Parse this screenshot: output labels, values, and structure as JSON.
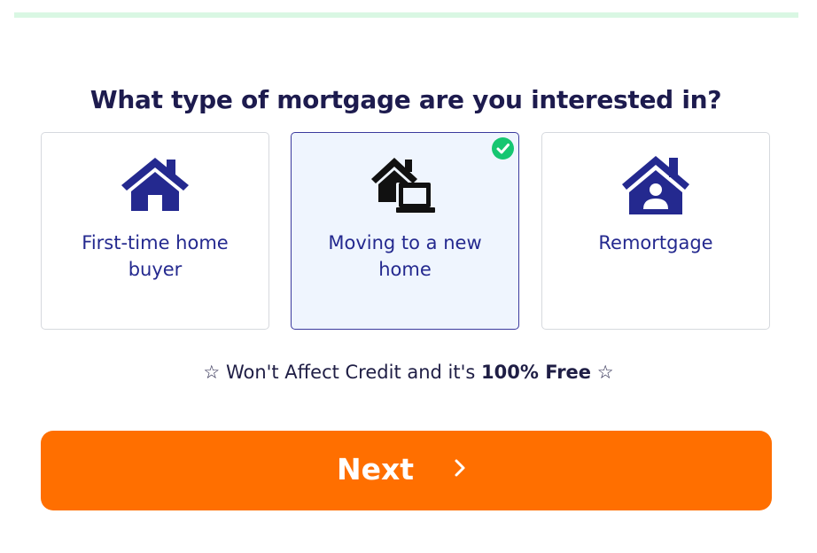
{
  "progress": {
    "value": 0.2,
    "color": "#d9f7e3"
  },
  "question": {
    "title": "What type of mortgage are you interested in?"
  },
  "options": [
    {
      "label": "First-time home buyer",
      "icon": "house-icon",
      "selected": false
    },
    {
      "label": "Moving to a new home",
      "icon": "moving-house-icon",
      "selected": true
    },
    {
      "label": "Remortgage",
      "icon": "house-user-icon",
      "selected": false
    }
  ],
  "trust": {
    "star_left": "☆",
    "text": "Won't Affect Credit and it's",
    "emphasis": "100% Free",
    "star_right": "☆"
  },
  "next_button": {
    "label": "Next",
    "icon": "chevron-right-icon"
  },
  "colors": {
    "accent": "#ff6f00",
    "brand_blue": "#24298f",
    "title": "#1d1b4e",
    "check_green": "#16c671",
    "selected_bg": "#eff5fe"
  }
}
